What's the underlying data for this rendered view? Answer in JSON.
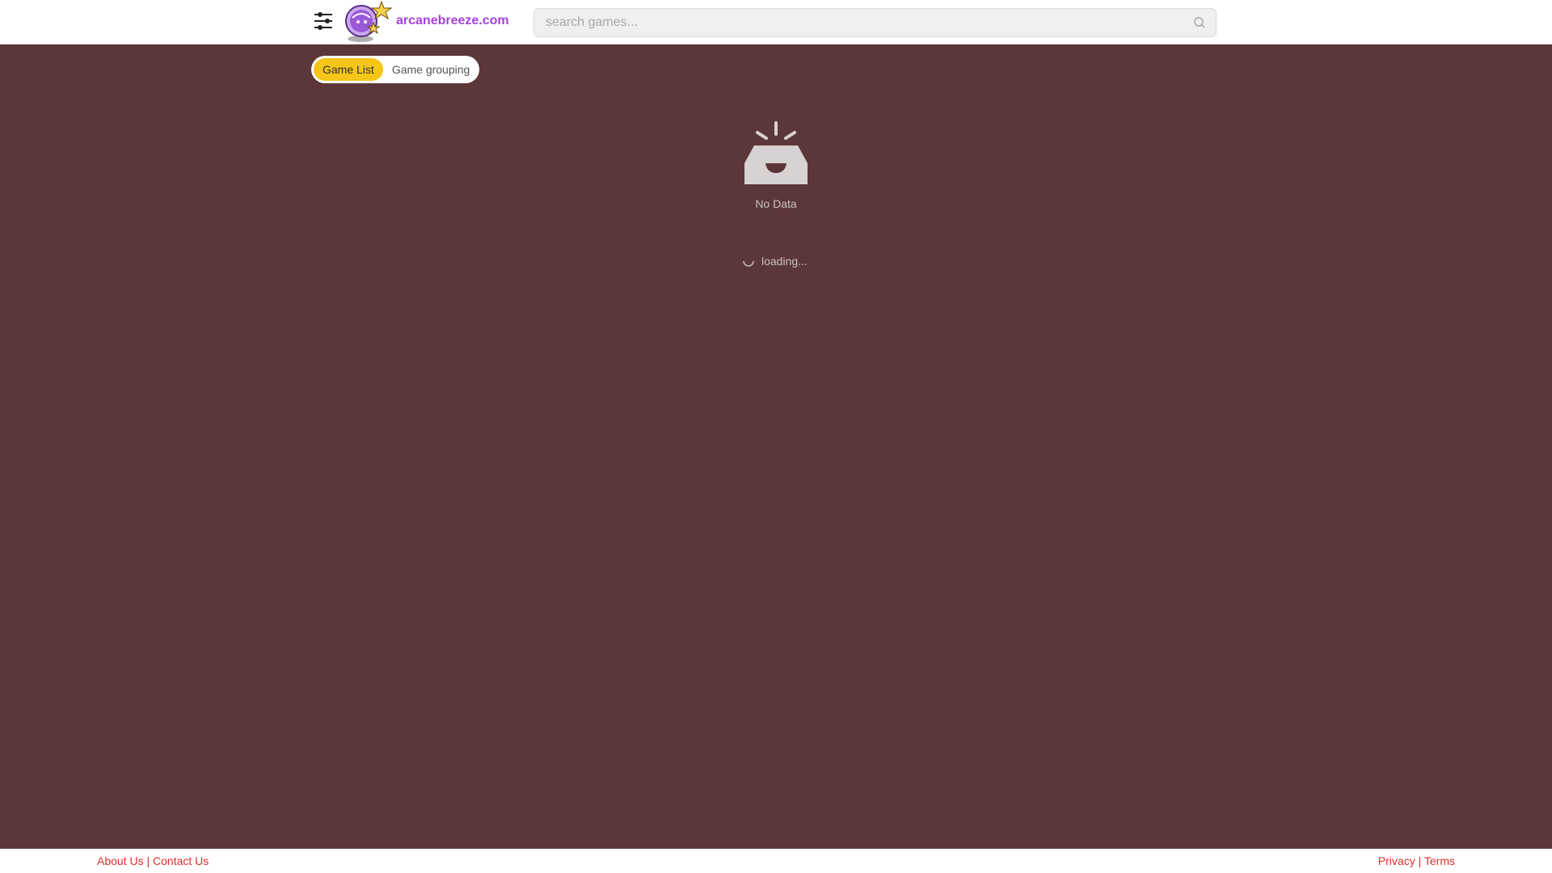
{
  "header": {
    "brand": "arcanebreeze.com",
    "menu_icon": "sliders-menu-icon",
    "logo_icon": "crystal-ball-mascot-logo",
    "search": {
      "placeholder": "search games...",
      "value": "",
      "icon": "search-icon"
    }
  },
  "tabs": [
    {
      "label": "Game List",
      "active": true
    },
    {
      "label": "Game grouping",
      "active": false
    }
  ],
  "empty_state": {
    "icon": "empty-inbox-icon",
    "text": "No Data"
  },
  "loading": {
    "icon": "spinner-icon",
    "text": "loading..."
  },
  "footer": {
    "left": {
      "about": "About Us",
      "separator": "|",
      "contact": "Contact Us"
    },
    "right": {
      "privacy": "Privacy",
      "separator": "|",
      "terms": "Terms"
    }
  },
  "colors": {
    "background": "#5c3739",
    "brand": "#a640e0",
    "tab_active": "#f5c518",
    "footer_link": "#e02b2b"
  }
}
